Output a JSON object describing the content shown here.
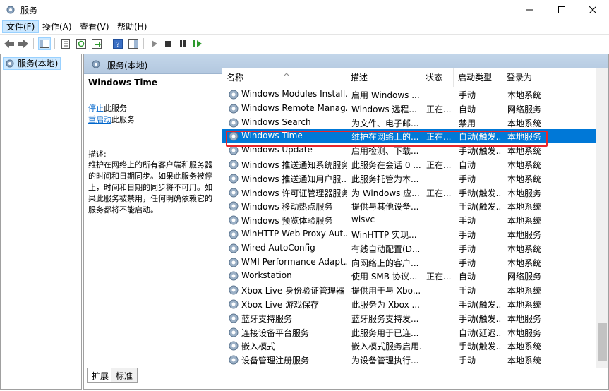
{
  "window": {
    "title": "服务"
  },
  "menu": [
    {
      "label": "文件(F)"
    },
    {
      "label": "操作(A)"
    },
    {
      "label": "查看(V)"
    },
    {
      "label": "帮助(H)"
    }
  ],
  "toolbar": {
    "buttons": [
      "back-icon",
      "forward-icon",
      "show-hide-tree-icon",
      "properties-icon",
      "refresh-icon",
      "export-list-icon",
      "help-icon",
      "show-action-pane-icon",
      "start-service-icon",
      "stop-service-icon",
      "pause-service-icon",
      "restart-service-icon"
    ]
  },
  "tree": {
    "item": "服务(本地)"
  },
  "panel": {
    "title": "服务(本地)",
    "selected_name": "Windows Time",
    "link_stop": "停止",
    "link_stop_suffix": "此服务",
    "link_restart": "重启动",
    "link_restart_suffix": "此服务",
    "desc_label": "描述:",
    "desc_text": "维护在网络上的所有客户端和服务器的时间和日期同步。如果此服务被停止，时间和日期的同步将不可用。如果此服务被禁用，任何明确依赖它的服务都将不能启动。"
  },
  "columns": [
    "名称",
    "描述",
    "状态",
    "启动类型",
    "登录为"
  ],
  "rows": [
    {
      "name": "Windows Modules Install...",
      "desc": "启用 Windows ...",
      "status": "",
      "startup": "手动",
      "logon": "本地系统"
    },
    {
      "name": "Windows Remote Manag...",
      "desc": "Windows 远程...",
      "status": "正在...",
      "startup": "自动",
      "logon": "网络服务"
    },
    {
      "name": "Windows Search",
      "desc": "为文件、电子邮...",
      "status": "",
      "startup": "禁用",
      "logon": "本地系统"
    },
    {
      "name": "Windows Time",
      "desc": "维护在网络上的...",
      "status": "正在...",
      "startup": "自动(触发...",
      "logon": "本地服务",
      "selected": true
    },
    {
      "name": "Windows Update",
      "desc": "启用检测、下载...",
      "status": "",
      "startup": "手动(触发...",
      "logon": "本地系统"
    },
    {
      "name": "Windows 推送通知系统服务",
      "desc": "此服务在会话 0 ...",
      "status": "正在...",
      "startup": "自动",
      "logon": "本地系统"
    },
    {
      "name": "Windows 推送通知用户服...",
      "desc": "此服务托管为本...",
      "status": "",
      "startup": "手动",
      "logon": "本地系统"
    },
    {
      "name": "Windows 许可证管理器服务",
      "desc": "为 Windows 应...",
      "status": "正在...",
      "startup": "手动(触发...",
      "logon": "本地服务"
    },
    {
      "name": "Windows 移动热点服务",
      "desc": "提供与其他设备...",
      "status": "",
      "startup": "手动(触发...",
      "logon": "本地系统"
    },
    {
      "name": "Windows 预览体验服务",
      "desc": "wisvc",
      "status": "",
      "startup": "手动",
      "logon": "本地系统"
    },
    {
      "name": "WinHTTP Web Proxy Aut...",
      "desc": "WinHTTP 实现...",
      "status": "",
      "startup": "手动",
      "logon": "本地服务"
    },
    {
      "name": "Wired AutoConfig",
      "desc": "有线自动配置(D...",
      "status": "",
      "startup": "手动",
      "logon": "本地系统"
    },
    {
      "name": "WMI Performance Adapt...",
      "desc": "向网络上的客户...",
      "status": "",
      "startup": "手动",
      "logon": "本地系统"
    },
    {
      "name": "Workstation",
      "desc": "使用 SMB 协议...",
      "status": "正在...",
      "startup": "自动",
      "logon": "网络服务"
    },
    {
      "name": "Xbox Live 身份验证管理器",
      "desc": "提供用于与 Xbo...",
      "status": "",
      "startup": "手动",
      "logon": "本地系统"
    },
    {
      "name": "Xbox Live 游戏保存",
      "desc": "此服务为 Xbox ...",
      "status": "",
      "startup": "手动(触发...",
      "logon": "本地系统"
    },
    {
      "name": "蓝牙支持服务",
      "desc": "蓝牙服务支持发...",
      "status": "",
      "startup": "手动(触发...",
      "logon": "本地服务"
    },
    {
      "name": "连接设备平台服务",
      "desc": "此服务用于已连...",
      "status": "",
      "startup": "自动(延迟...",
      "logon": "本地服务"
    },
    {
      "name": "嵌入模式",
      "desc": "嵌入模式服务启用...",
      "status": "",
      "startup": "手动(触发...",
      "logon": "本地系统"
    },
    {
      "name": "设备管理注册服务",
      "desc": "为设备管理执行...",
      "status": "",
      "startup": "手动",
      "logon": "本地系统"
    }
  ],
  "tabs": [
    "扩展",
    "标准"
  ]
}
